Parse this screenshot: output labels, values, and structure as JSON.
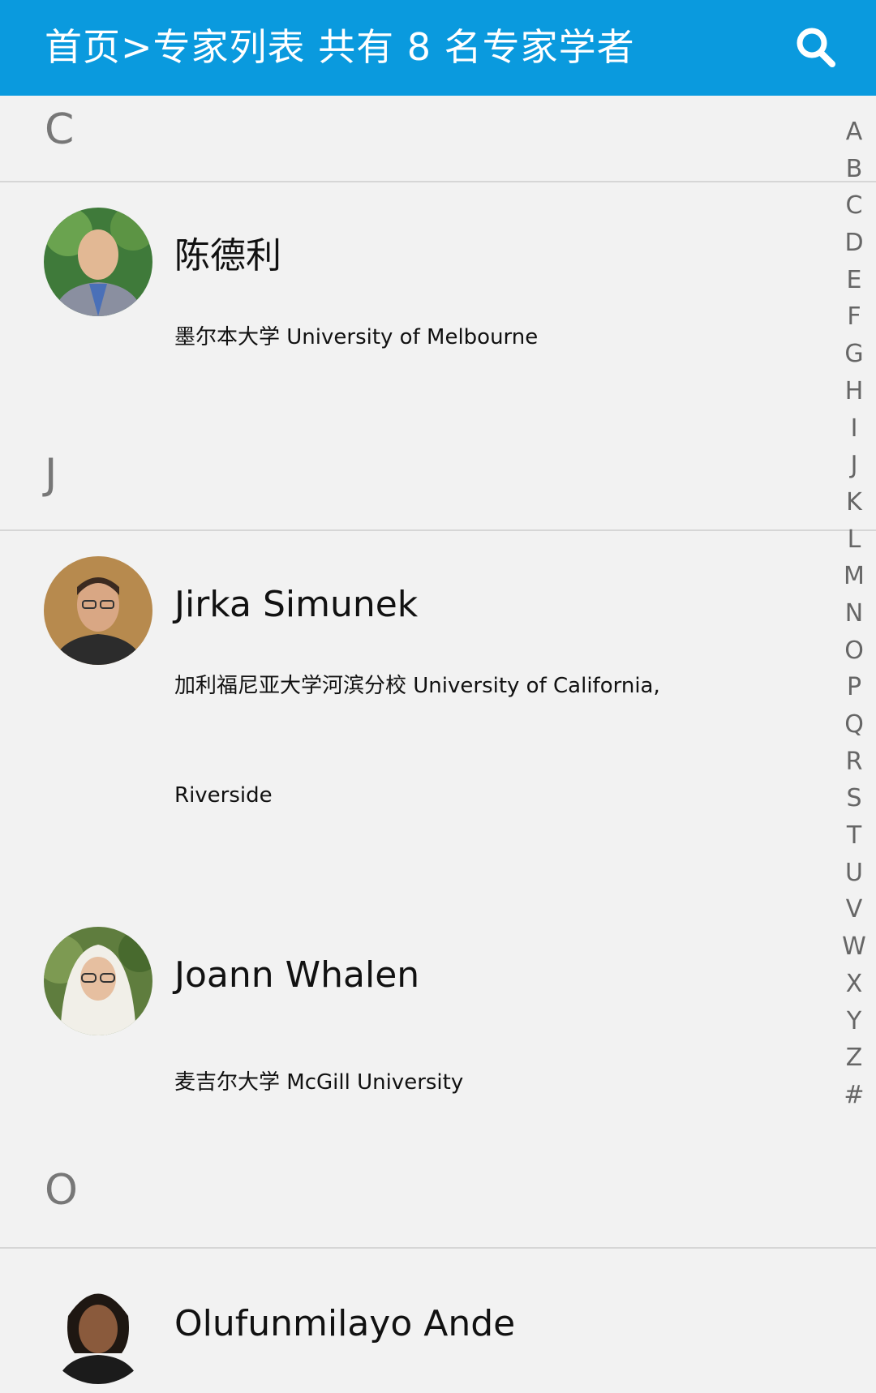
{
  "header": {
    "title": "首页>专家列表 共有 8 名专家学者",
    "search_icon": "search-icon"
  },
  "sections": [
    {
      "letter": "C",
      "experts": [
        {
          "name": "陈德利",
          "affiliation": "墨尔本大学 University of Melbourne"
        }
      ]
    },
    {
      "letter": "J",
      "experts": [
        {
          "name": "Jirka Simunek",
          "affiliation_line1": "加利福尼亚大学河滨分校 University of California,",
          "affiliation_line2": "Riverside"
        },
        {
          "name": "Joann Whalen",
          "affiliation": "麦吉尔大学 McGill University"
        }
      ]
    },
    {
      "letter": "O",
      "experts": [
        {
          "name": "Olufunmilayo Ande"
        }
      ]
    }
  ],
  "alphabet_index": [
    "A",
    "B",
    "C",
    "D",
    "E",
    "F",
    "G",
    "H",
    "I",
    "J",
    "K",
    "L",
    "M",
    "N",
    "O",
    "P",
    "Q",
    "R",
    "S",
    "T",
    "U",
    "V",
    "W",
    "X",
    "Y",
    "Z",
    "#"
  ]
}
